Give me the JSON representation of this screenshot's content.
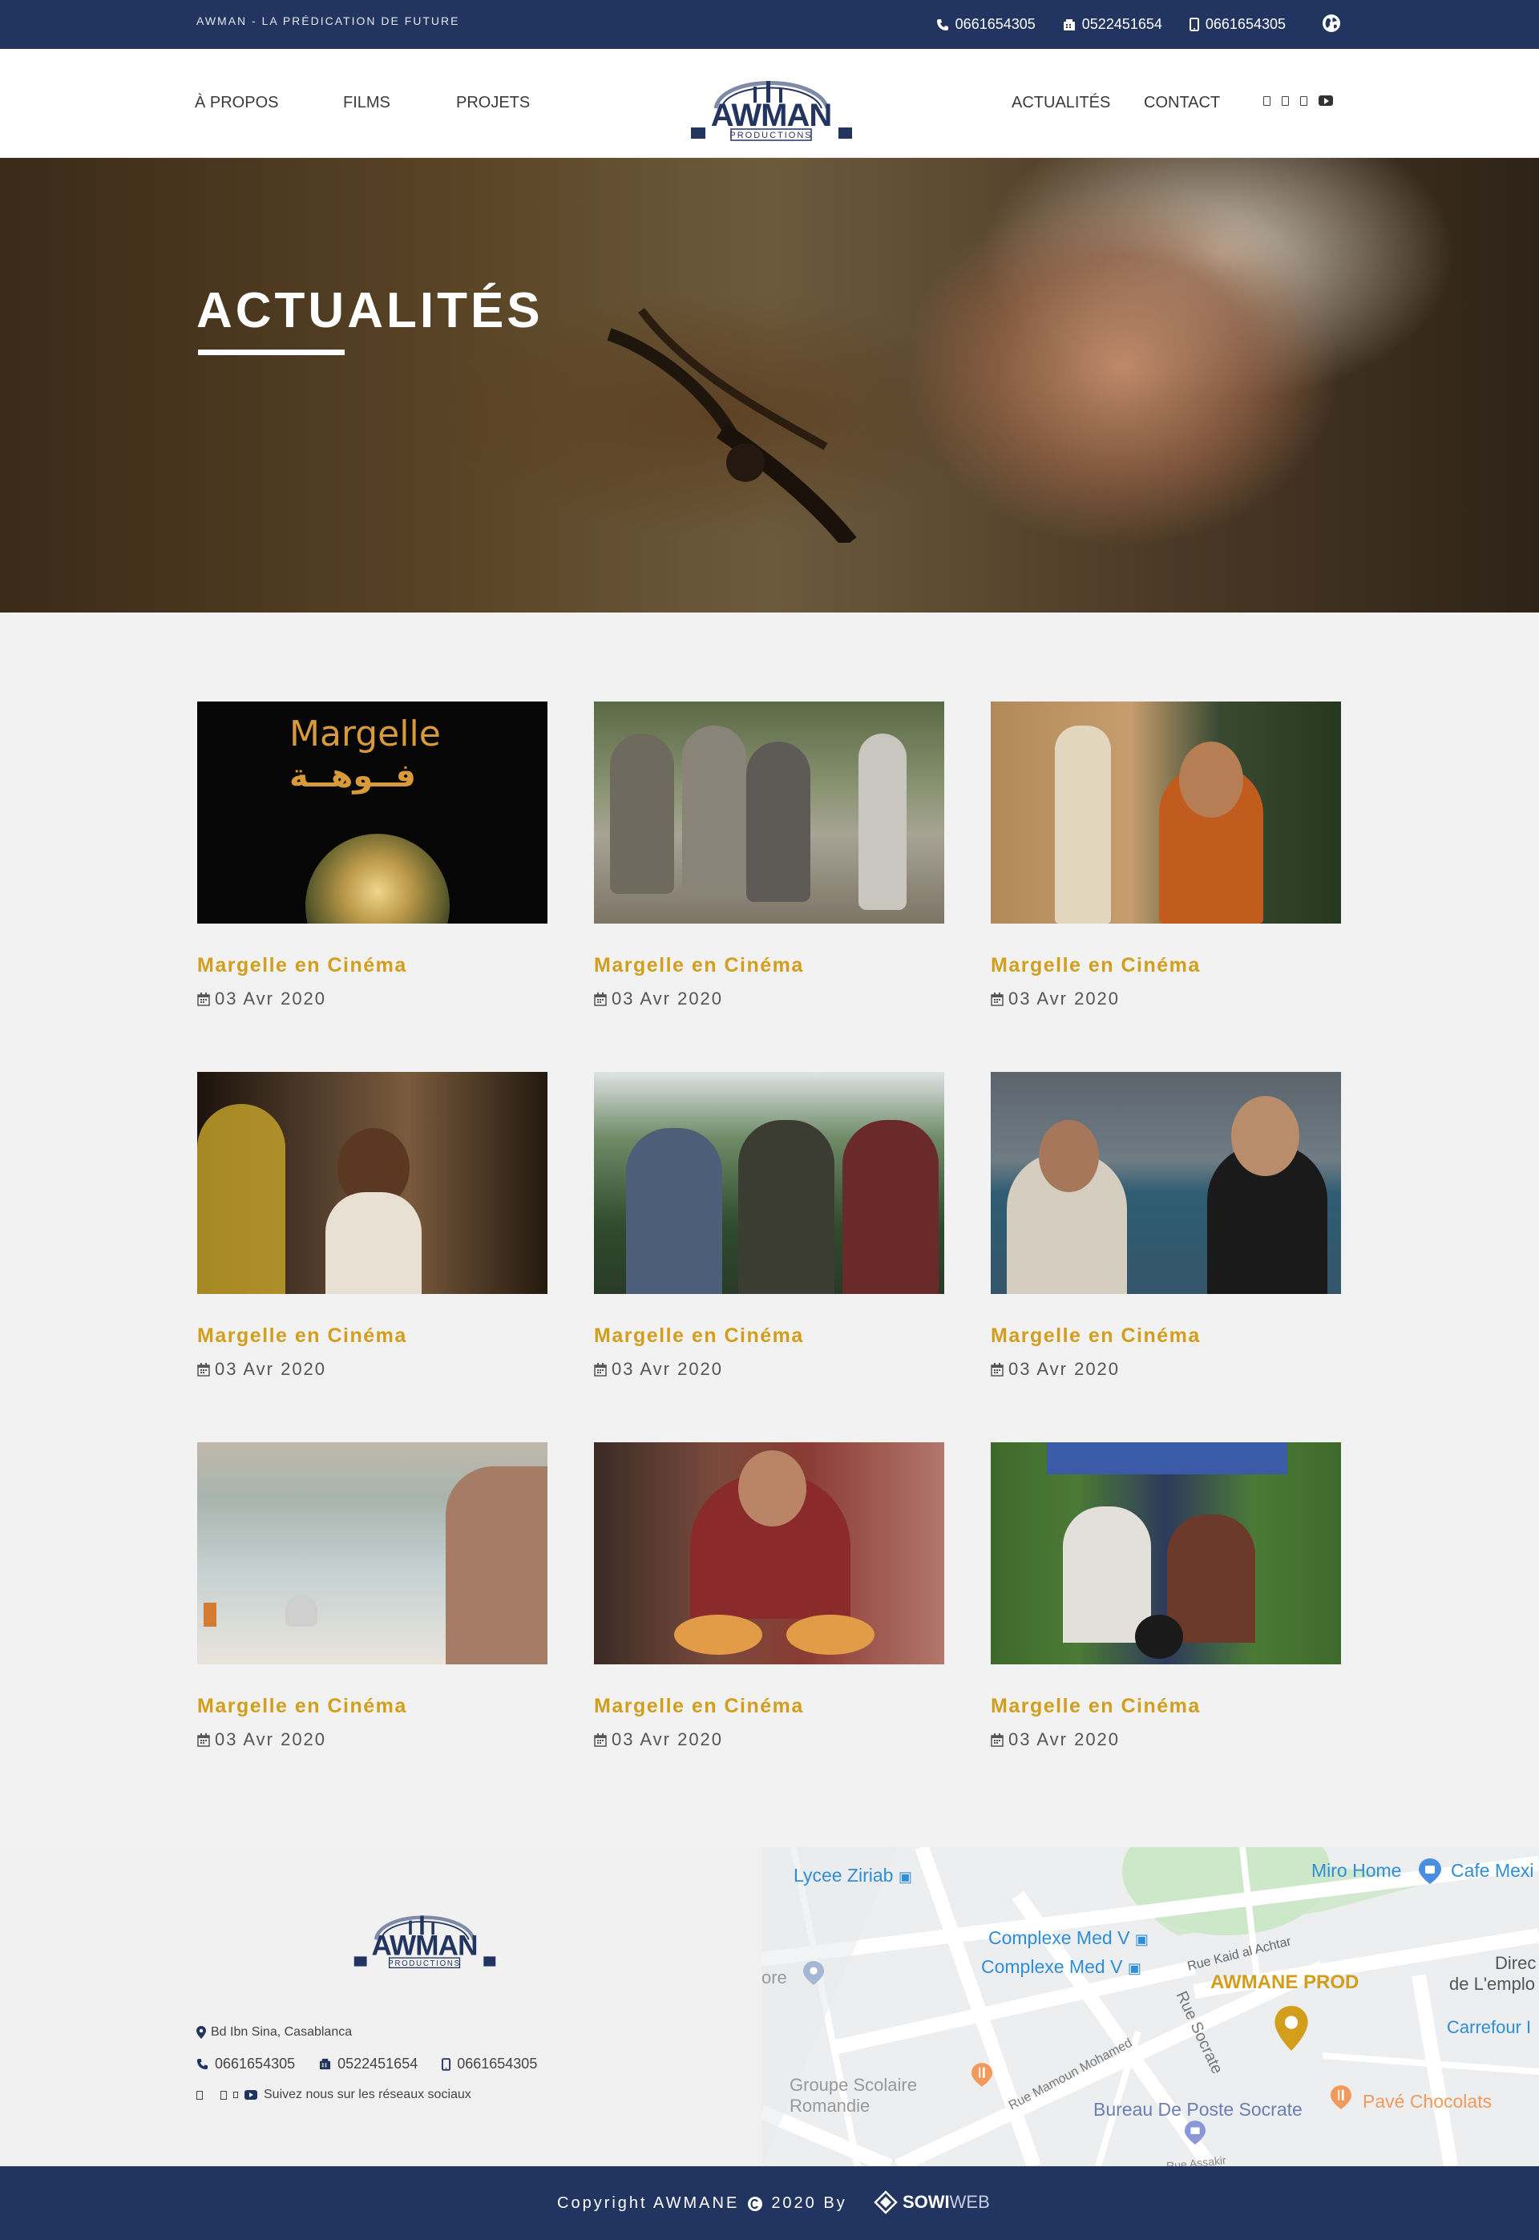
{
  "topbar": {
    "tagline": "AWMAN - LA PRÉDICATION DE FUTURE",
    "phone1": "0661654305",
    "fax": "0522451654",
    "mobile": "0661654305"
  },
  "nav": {
    "about": "À PROPOS",
    "films": "FILMS",
    "projects": "PROJETS",
    "news": "ACTUALITÉS",
    "contact": "CONTACT"
  },
  "logo": {
    "name": "AWMAN",
    "sub": "PRODUCTIONS"
  },
  "hero": {
    "title": "ACTUALITÉS"
  },
  "cards": [
    {
      "title": "Margelle en Cinéma",
      "date": "03 Avr 2020",
      "thumb_text": "Margelle",
      "thumb_arabic": "فــوهــة"
    },
    {
      "title": "Margelle en Cinéma",
      "date": "03 Avr 2020"
    },
    {
      "title": "Margelle en Cinéma",
      "date": "03 Avr 2020"
    },
    {
      "title": "Margelle en Cinéma",
      "date": "03 Avr 2020"
    },
    {
      "title": "Margelle en Cinéma",
      "date": "03 Avr 2020"
    },
    {
      "title": "Margelle en Cinéma",
      "date": "03 Avr 2020"
    },
    {
      "title": "Margelle en Cinéma",
      "date": "03 Avr 2020"
    },
    {
      "title": "Margelle en Cinéma",
      "date": "03 Avr 2020"
    },
    {
      "title": "Margelle en Cinéma",
      "date": "03 Avr 2020"
    }
  ],
  "footer": {
    "address": "Bd Ibn Sina, Casablanca",
    "phone1": "0661654305",
    "fax": "0522451654",
    "mobile": "0661654305",
    "social_text": "Suivez nous sur les réseaux sociaux"
  },
  "map": {
    "labels": {
      "lycee": "Lycee Ziriab",
      "miro": "Miro Home",
      "cafe": "Cafe Mexi",
      "complexe1": "Complexe Med V",
      "complexe2": "Complexe Med V",
      "kaid": "Rue Kaid al Achtar",
      "direc": "Direc",
      "emploi": "de L'emplo",
      "carrefour": "Carrefour I",
      "awmane": "AWMANE PROD",
      "mamoun": "Rue Mamoun Mohamed",
      "socrate": "Rue Socrate",
      "groupe": "Groupe Scolaire",
      "romandie": "Romandie",
      "poste": "Bureau De Poste Socrate",
      "pave": "Pavé Chocolats",
      "ore": "ore",
      "assakir": "Rue Assakir"
    }
  },
  "bottom": {
    "copyright": "Copyright AWMANE",
    "year": "2020 By",
    "brand_sowi": "SOWI",
    "brand_web": "WEB"
  },
  "colors": {
    "navy": "#223460",
    "gold": "#d39e1b",
    "map_blue": "#2f8ed8"
  }
}
